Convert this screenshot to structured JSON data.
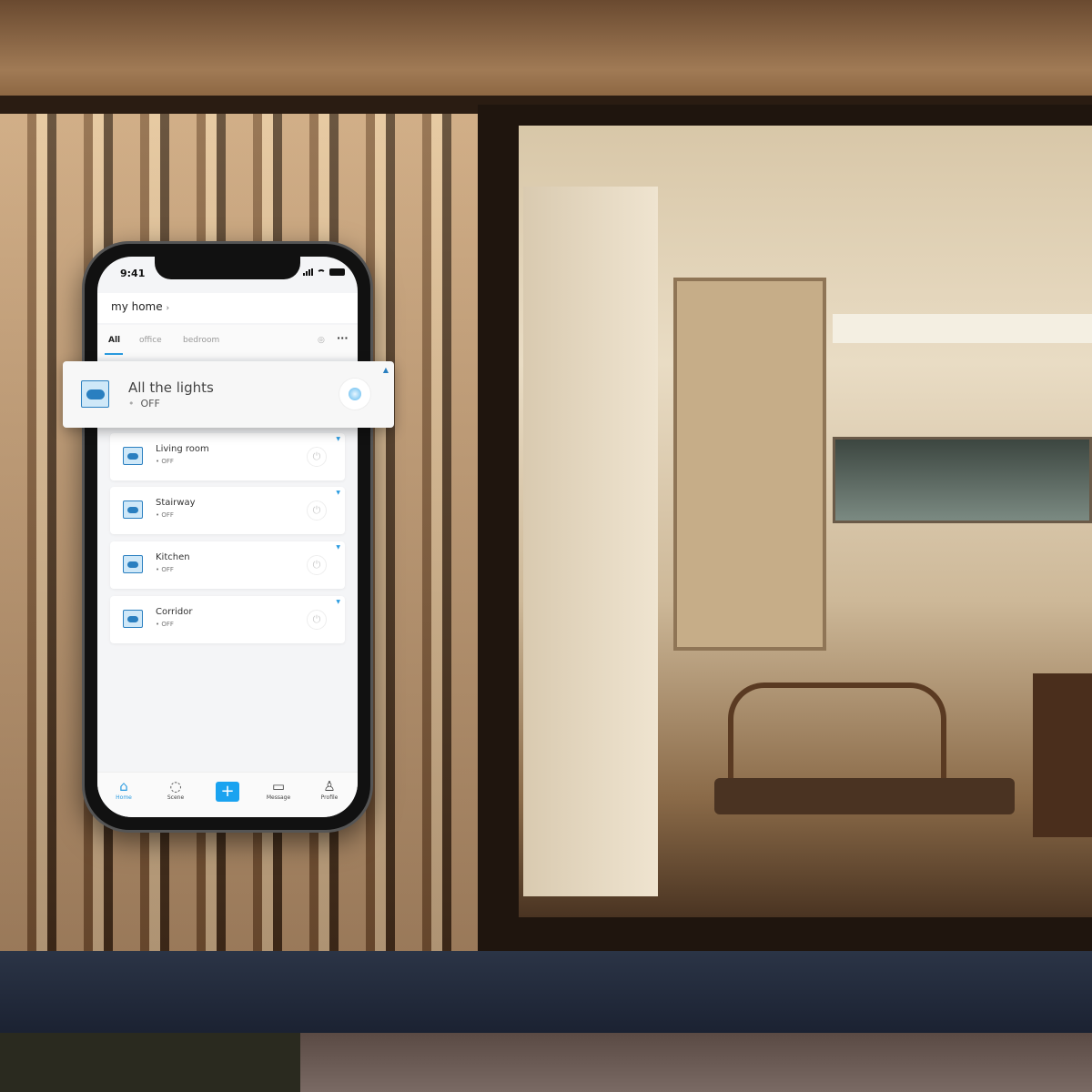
{
  "status_bar": {
    "time": "9:41"
  },
  "header": {
    "title": "my home",
    "chevron": "›"
  },
  "tabs": [
    {
      "label": "All",
      "active": true
    },
    {
      "label": "office"
    },
    {
      "label": "bedroom"
    }
  ],
  "tab_icons": {
    "eye": "eye-icon",
    "more": "···"
  },
  "popup": {
    "name": "All the lights",
    "status": "OFF",
    "dot": "•"
  },
  "devices": [
    {
      "name": "Living room",
      "status": "OFF"
    },
    {
      "name": "Stairway",
      "status": "OFF"
    },
    {
      "name": "Kitchen",
      "status": "OFF"
    },
    {
      "name": "Corridor",
      "status": "OFF"
    }
  ],
  "nav": [
    {
      "label": "Home",
      "icon": "⌂",
      "active": true
    },
    {
      "label": "Scene",
      "icon": "◌"
    },
    {
      "label": "+",
      "icon": "plus-icon"
    },
    {
      "label": "Message",
      "icon": "▭"
    },
    {
      "label": "Profile",
      "icon": "♙"
    }
  ],
  "colors": {
    "accent": "#1aa3f0",
    "switch": "#2a7fc0"
  }
}
